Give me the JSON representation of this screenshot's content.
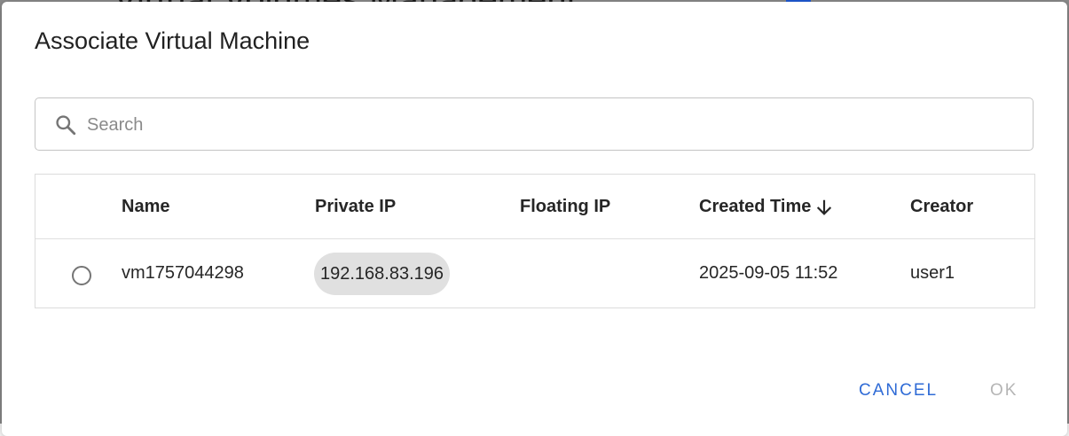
{
  "background": {
    "title_fragment": "Virtual Volumes Management"
  },
  "dialog": {
    "title": "Associate Virtual Machine",
    "search": {
      "placeholder": "Search",
      "value": "",
      "icon": "search-icon"
    },
    "table": {
      "columns": [
        {
          "label": "Name"
        },
        {
          "label": "Private IP"
        },
        {
          "label": "Floating IP"
        },
        {
          "label": "Created Time",
          "sorted": "descending",
          "sort_icon": "arrow-down-icon"
        },
        {
          "label": "Creator"
        }
      ],
      "rows": [
        {
          "selected": false,
          "name": "vm1757044298",
          "private_ip": "192.168.83.196",
          "floating_ip": "",
          "created_time": "2025-09-05 11:52",
          "creator": "user1"
        }
      ]
    },
    "actions": {
      "cancel_label": "CANCEL",
      "ok_label": "OK",
      "ok_enabled": false
    }
  },
  "colors": {
    "accent": "#2f6bd6",
    "disabled": "#b5b5b5",
    "chip_bg": "#e0e0e0",
    "backdrop": "#8c8c8c"
  }
}
